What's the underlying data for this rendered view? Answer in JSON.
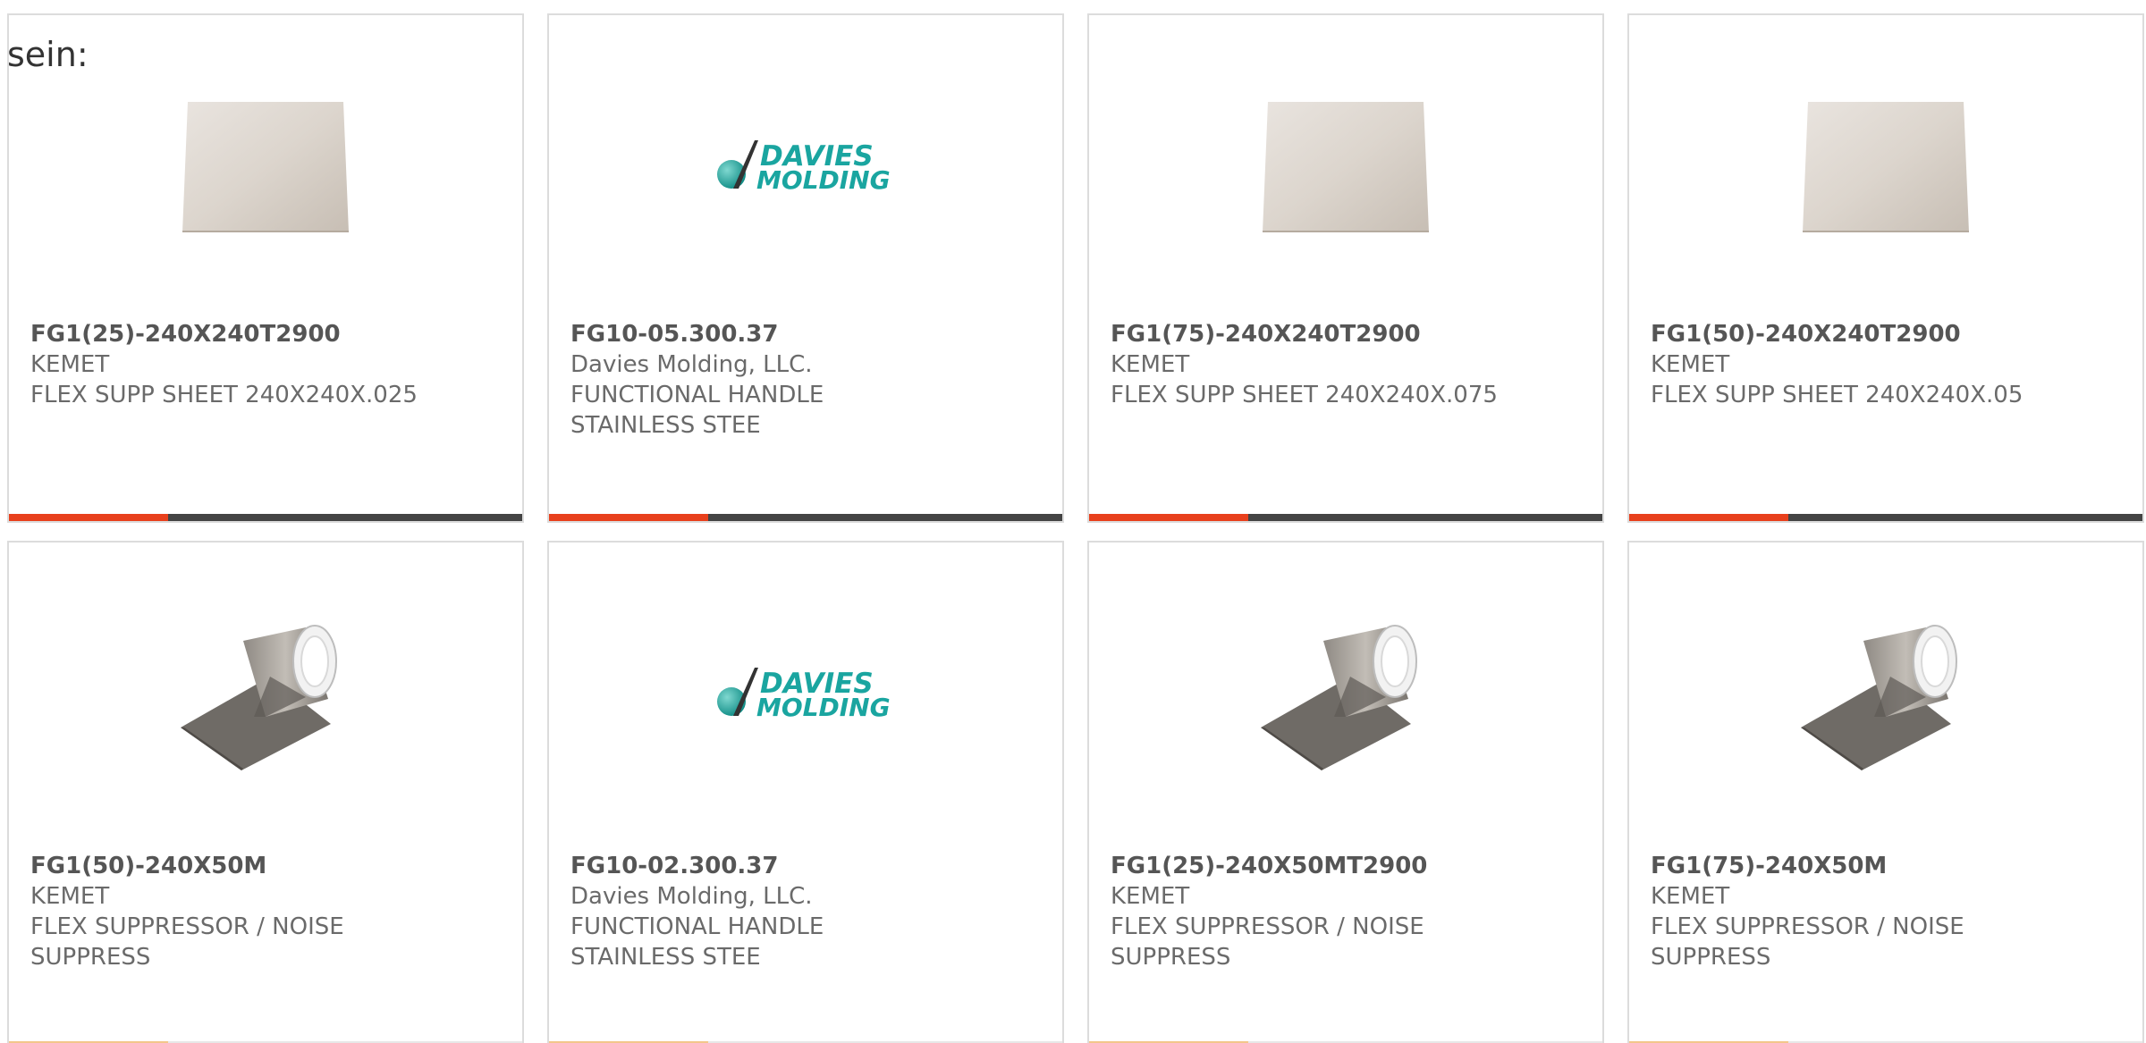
{
  "intro_text": "sein:",
  "colors": {
    "accent": "#e8401c",
    "bar_dark": "#444444",
    "text": "#6a6a6a",
    "davies_teal": "#1aa5a0"
  },
  "products": [
    {
      "part_number": "FG1(25)-240X240T2900",
      "manufacturer": "KEMET",
      "description": "FLEX SUPP SHEET 240X240X.025",
      "image_icon": "sheet-image",
      "progress": 0.31
    },
    {
      "part_number": "FG10-05.300.37",
      "manufacturer": "Davies Molding, LLC.",
      "description": "FUNCTIONAL HANDLE STAINLESS STEE",
      "image_icon": "davies-molding-logo",
      "progress": 0.31
    },
    {
      "part_number": "FG1(75)-240X240T2900",
      "manufacturer": "KEMET",
      "description": "FLEX SUPP SHEET 240X240X.075",
      "image_icon": "sheet-image",
      "progress": 0.31
    },
    {
      "part_number": "FG1(50)-240X240T2900",
      "manufacturer": "KEMET",
      "description": "FLEX SUPP SHEET 240X240X.05",
      "image_icon": "sheet-image",
      "progress": 0.31
    },
    {
      "part_number": "FG1(50)-240X50M",
      "manufacturer": "KEMET",
      "description": "FLEX SUPPRESSOR / NOISE SUPPRESS",
      "image_icon": "roll-image",
      "progress": 0.31
    },
    {
      "part_number": "FG10-02.300.37",
      "manufacturer": "Davies Molding, LLC.",
      "description": "FUNCTIONAL HANDLE STAINLESS STEE",
      "image_icon": "davies-molding-logo",
      "progress": 0.31
    },
    {
      "part_number": "FG1(25)-240X50MT2900",
      "manufacturer": "KEMET",
      "description": "FLEX SUPPRESSOR / NOISE SUPPRESS",
      "image_icon": "roll-image",
      "progress": 0.31
    },
    {
      "part_number": "FG1(75)-240X50M",
      "manufacturer": "KEMET",
      "description": "FLEX SUPPRESSOR / NOISE SUPPRESS",
      "image_icon": "roll-image",
      "progress": 0.31
    }
  ],
  "logo": {
    "line1": "DAVIES",
    "line2": "MOLDING"
  }
}
